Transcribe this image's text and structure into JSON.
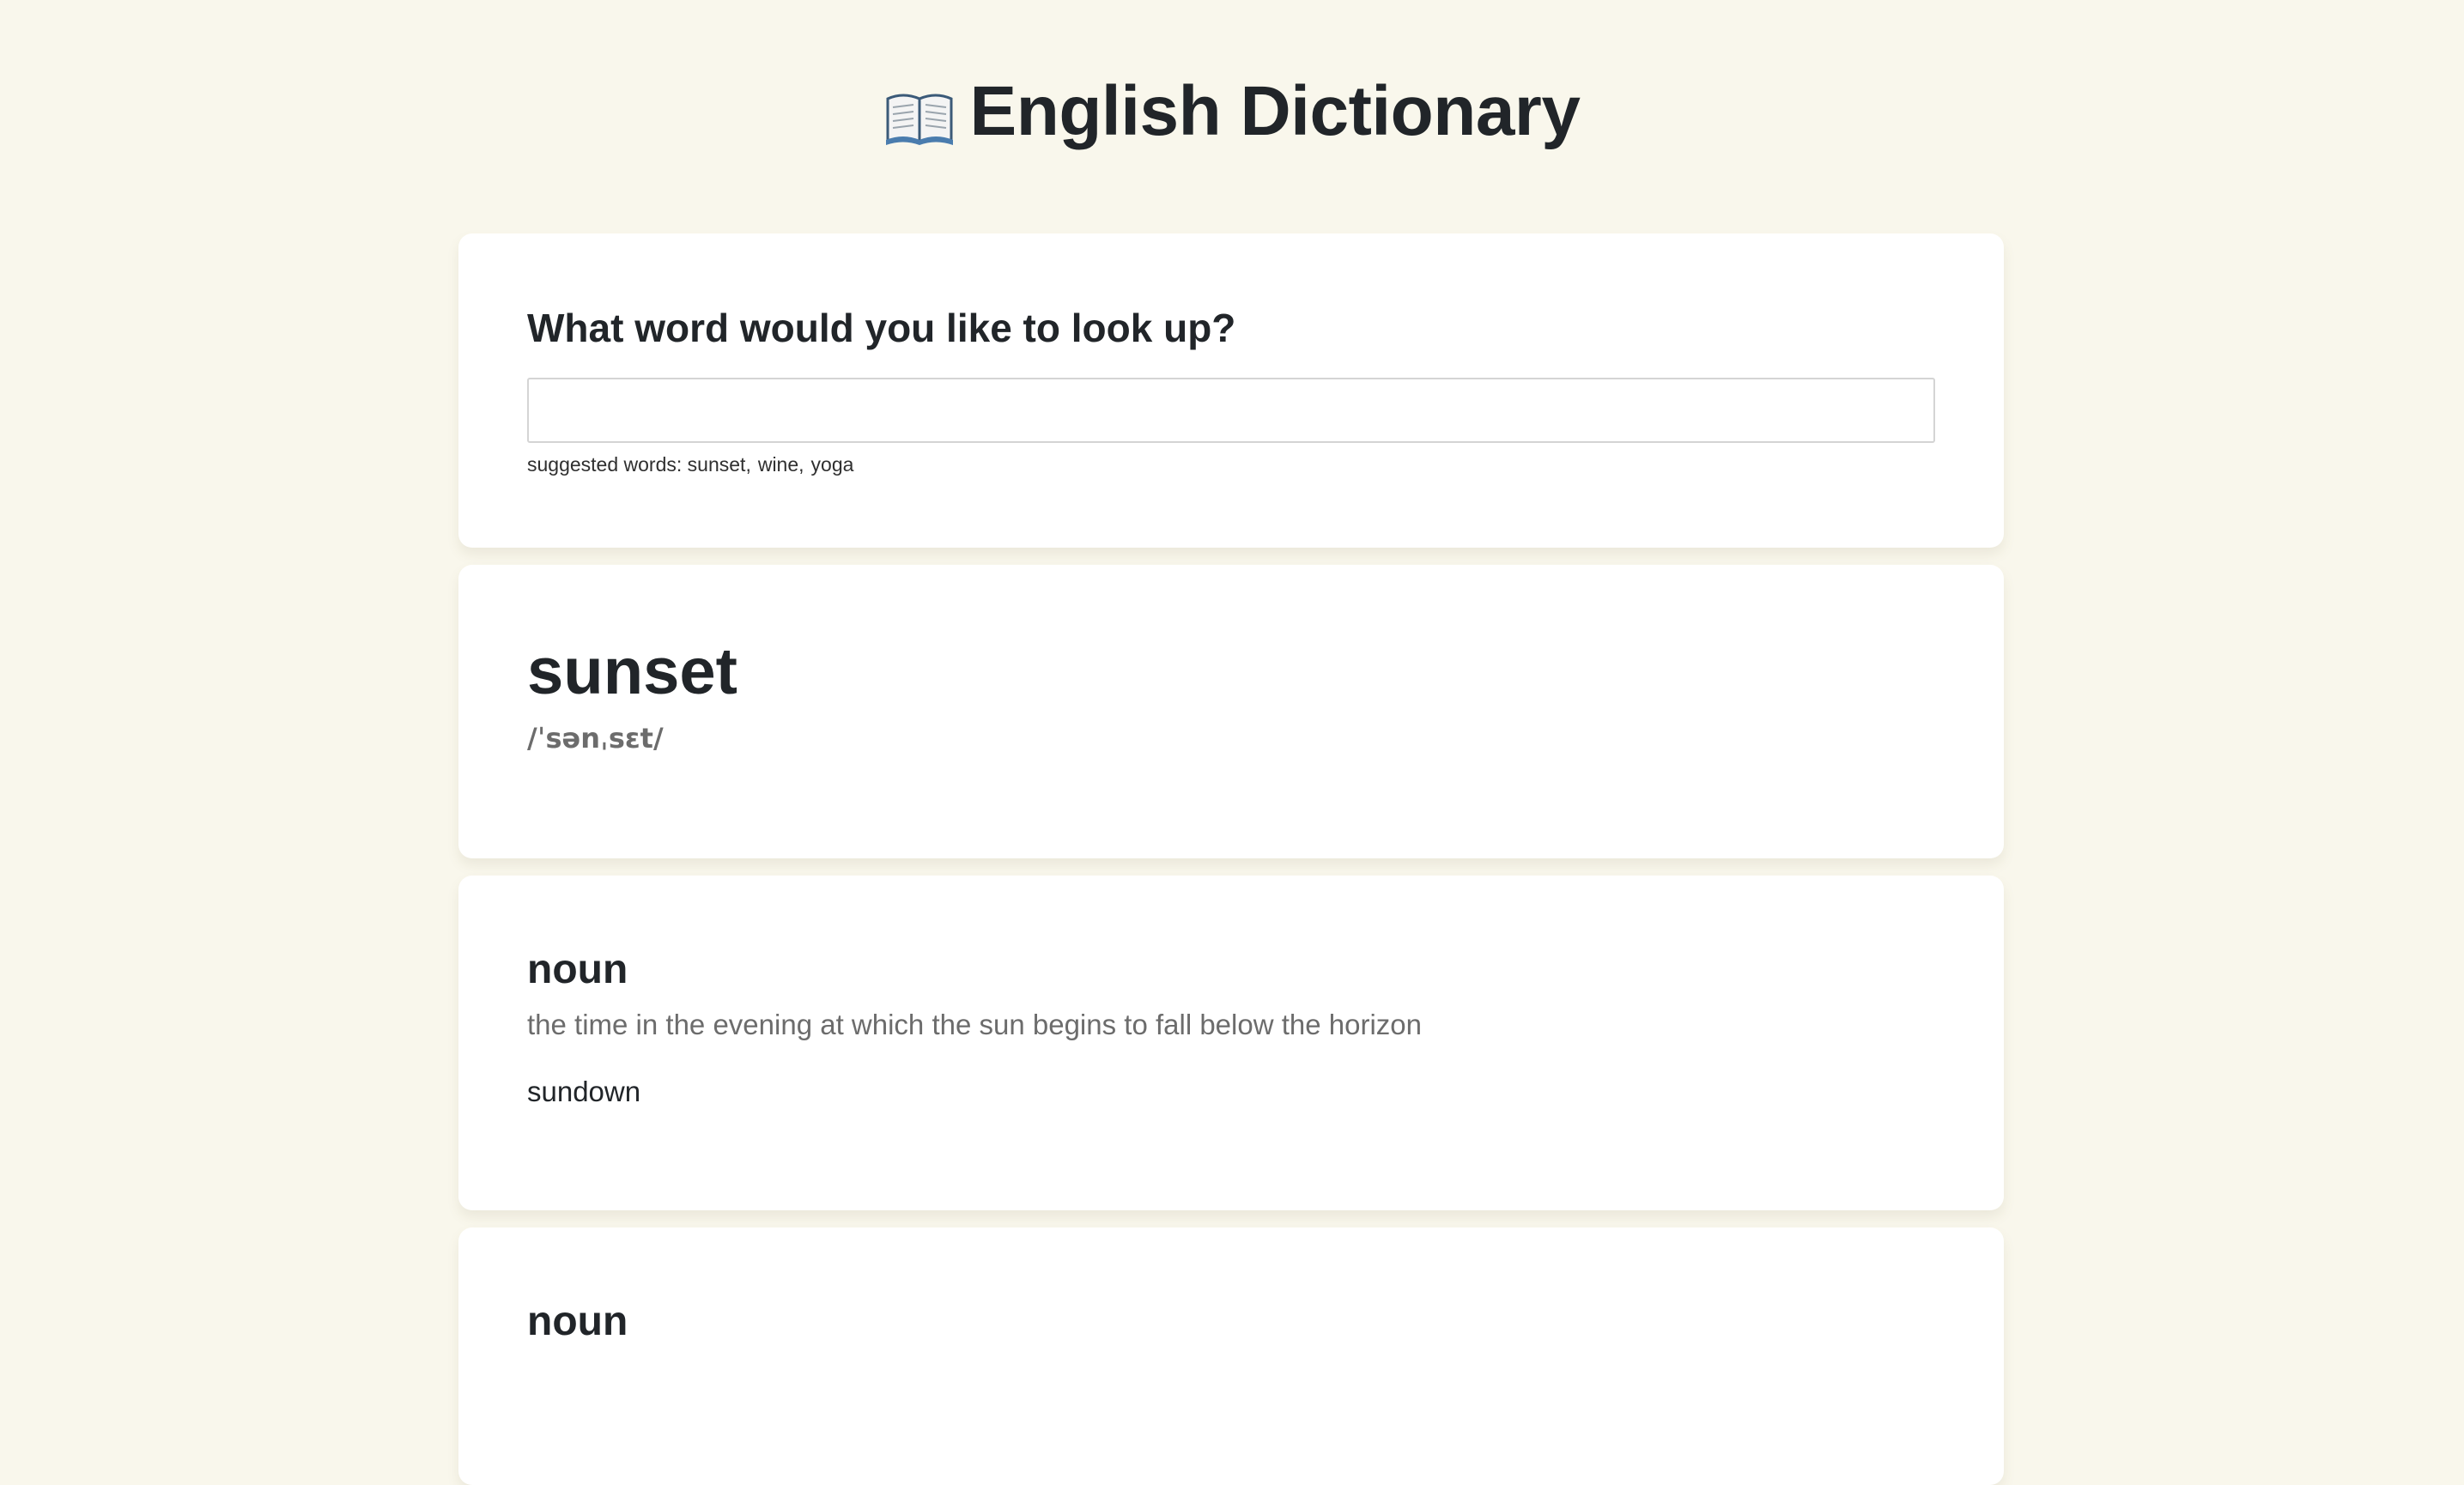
{
  "app": {
    "title": "English Dictionary",
    "icon": "open-book-icon"
  },
  "search": {
    "prompt": "What word would you like to look up?",
    "value": "",
    "placeholder": "",
    "suggestions_label": "suggested words:",
    "suggestions": [
      "sunset",
      "wine",
      "yoga"
    ]
  },
  "result": {
    "word": "sunset",
    "phonetic": "/ˈsənˌsɛt/",
    "meanings": [
      {
        "part_of_speech": "noun",
        "definition": "the time in the evening at which the sun begins to fall below the horizon",
        "synonym": "sundown"
      },
      {
        "part_of_speech": "noun"
      }
    ]
  },
  "colors": {
    "background": "#f9f7ec",
    "card": "#ffffff",
    "text": "#212529",
    "muted": "#6c6c6c"
  }
}
